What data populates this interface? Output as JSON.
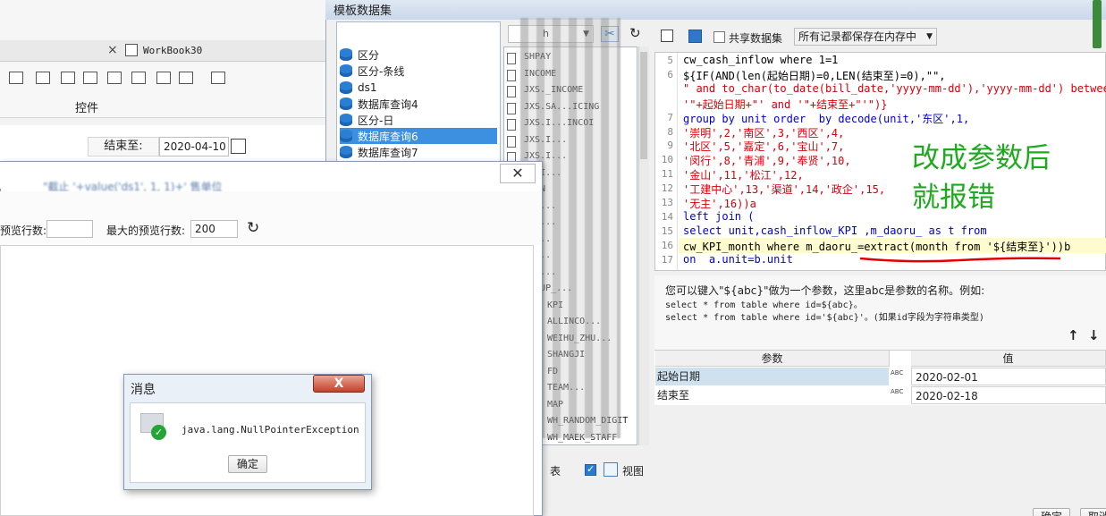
{
  "designer": {
    "tab_close": "×",
    "tab_label": "WorkBook30",
    "toolbar_group_label": "控件",
    "end_label": "结束至:",
    "end_value": "2020-04-10"
  },
  "dataset_dialog": {
    "title": "模板数据集",
    "datasets": [
      {
        "label": "区分",
        "selected": false
      },
      {
        "label": "区分-条线",
        "selected": false
      },
      {
        "label": "ds1",
        "selected": false
      },
      {
        "label": "数据库查询4",
        "selected": false
      },
      {
        "label": "区分-日",
        "selected": false
      },
      {
        "label": "数据库查询6",
        "selected": true
      },
      {
        "label": "数据库查询7",
        "selected": false
      }
    ],
    "search_fragment": "h",
    "tables": [
      "SHPAY",
      "INCOME",
      "JXS._INCOME",
      "JXS.SA...ICING",
      "JXS.I...INCOI",
      "JXS.I...",
      "JXS.I...",
      "ON_I...",
      "_BAN",
      "ORK...",
      "N_R...",
      "CI...",
      "_I...",
      "_DA...",
      "GROUP_...",
      "KPI",
      "ALLINCO...",
      "WEIHU_ZHU...",
      "SHANGJI",
      "FD",
      "TEAM...",
      "MAP",
      "WH_RANDOM_DIGIT",
      "WH_MAEK_STAFF"
    ],
    "share_label": "共享数据集",
    "memory_option": "所有记录都保存在内存中",
    "table_label": "表",
    "view_label": "视图",
    "sql_lines": [
      {
        "no": "5",
        "text": "cw_cash_inflow where 1=1"
      },
      {
        "no": "6",
        "text": "${IF(AND(len(起始日期)=0,LEN(结束至)=0),\"\","
      },
      {
        "no": "",
        "text": "\" and to_char(to_date(bill_date,'yyyy-mm-dd'),'yyyy-mm-dd') between"
      },
      {
        "no": "",
        "text": "'\"+起始日期+\"' and '\"+结束至+\"'\")}"
      },
      {
        "no": "7",
        "text": "group by unit order  by decode(unit,'东区',1,"
      },
      {
        "no": "8",
        "text": "'崇明',2,'南区',3,'西区',4,"
      },
      {
        "no": "9",
        "text": "'北区',5,'嘉定',6,'宝山',7,"
      },
      {
        "no": "10",
        "text": "'闵行',8,'青浦',9,'奉贤',10,"
      },
      {
        "no": "11",
        "text": "'金山',11,'松江',12,"
      },
      {
        "no": "12",
        "text": "'工建中心',13,'渠道',14,'政企',15,"
      },
      {
        "no": "13",
        "text": "'无主',16))a"
      },
      {
        "no": "14",
        "text": "left join ("
      },
      {
        "no": "15",
        "text": "select unit,cash_inflow_KPI ,m_daoru_ as t from"
      },
      {
        "no": "16",
        "text": "cw_KPI_month where m_daoru_=extract(month from '${结束至}'))b"
      },
      {
        "no": "17",
        "text": "on  a.unit=b.unit"
      }
    ],
    "annotation_lines": [
      "改成参数后",
      "就报错"
    ],
    "help_lines": [
      "您可以键入\"${abc}\"做为一个参数，这里abc是参数的名称。例如:",
      "select * from table where id=${abc}。",
      "select * from table where id='${abc}'。(如果id字段为字符串类型)"
    ],
    "param_header_name": "参数",
    "param_header_value": "值",
    "params": [
      {
        "name": "起始日期",
        "type": "ABC",
        "value": "2020-02-01"
      },
      {
        "name": "结束至",
        "type": "ABC",
        "value": "2020-02-18"
      }
    ],
    "ok_button": "确定",
    "cancel_button": "取消"
  },
  "preview_dialog": {
    "title_fragment": "\"截止 '+value('ds1', 1, 1)+' 售单位",
    "preview_rows_label": "预览行数:",
    "preview_rows_value": "",
    "max_rows_label": "最大的预览行数:",
    "max_rows_value": "200"
  },
  "message_dialog": {
    "title": "消息",
    "close": "X",
    "message": "java.lang.NullPointerException",
    "ok": "确定"
  }
}
